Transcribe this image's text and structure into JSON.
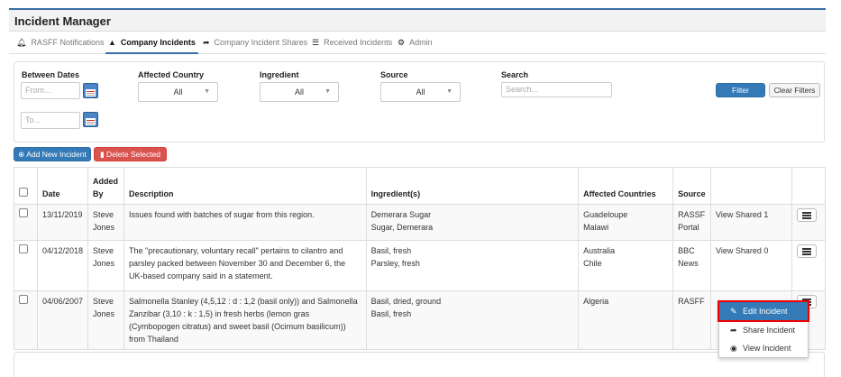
{
  "app": {
    "title": "Incident Manager"
  },
  "tabs": [
    {
      "icon": "bell-icon",
      "label": "RASFF Notifications",
      "active": false
    },
    {
      "icon": "warning-icon",
      "label": "Company Incidents",
      "active": true
    },
    {
      "icon": "share-icon",
      "label": "Company Incident Shares",
      "active": false
    },
    {
      "icon": "list-icon",
      "label": "Received Incidents",
      "active": false
    },
    {
      "icon": "gear-icon",
      "label": "Admin",
      "active": false
    }
  ],
  "filters": {
    "between_dates_label": "Between Dates",
    "from_placeholder": "From...",
    "to_placeholder": "To...",
    "affected_country_label": "Affected Country",
    "affected_country_value": "All",
    "ingredient_label": "Ingredient",
    "ingredient_value": "All",
    "source_label": "Source",
    "source_value": "All",
    "search_label": "Search",
    "search_placeholder": "Search...",
    "filter_button": "Filter",
    "clear_button": "Clear Filters"
  },
  "actions": {
    "add_new": "Add New Incident",
    "delete_selected": "Delete Selected"
  },
  "table": {
    "headers": [
      "Date",
      "Added By",
      "Description",
      "Ingredient(s)",
      "Affected Countries",
      "Source"
    ],
    "rows": [
      {
        "date": "13/11/2019",
        "added_by": "Steve Jones",
        "description": "Issues found with batches of sugar from this region.",
        "ingredients": [
          "Demerara Sugar",
          "Sugar, Demerara"
        ],
        "countries": [
          "Guadeloupe",
          "Malawi"
        ],
        "source": "RASSF Portal",
        "shared": "View Shared 1"
      },
      {
        "date": "04/12/2018",
        "added_by": "Steve Jones",
        "description": "The \"precautionary, voluntary recall\" pertains to cilantro and parsley packed between November 30 and December 6, the UK-based company said in a statement.",
        "ingredients": [
          "Basil, fresh",
          "Parsley, fresh"
        ],
        "countries": [
          "Australia",
          "Chile"
        ],
        "source": "BBC News",
        "shared": "View Shared 0"
      },
      {
        "date": "04/06/2007",
        "added_by": "Steve Jones",
        "description": "Salmonella Stanley (4,5,12 : d : 1,2 (basil only)) and Salmonella Zanzibar (3,10 : k : 1,5) in fresh herbs (lemon gras (Cymbopogen citratus) and sweet basil (Ocimum basilicum)) from Thailand",
        "ingredients": [
          "Basil, dried, ground",
          "Basil, fresh"
        ],
        "countries": [
          "Algeria"
        ],
        "source": "RASFF",
        "shared": ""
      }
    ]
  },
  "row_menu": {
    "items": [
      {
        "icon": "edit-icon",
        "label": "Edit Incident"
      },
      {
        "icon": "share-icon",
        "label": "Share Incident"
      },
      {
        "icon": "eye-icon",
        "label": "View Incident"
      }
    ]
  },
  "colors": {
    "accent": "#337ab7",
    "danger": "#d9534f",
    "highlight": "#e00000"
  }
}
